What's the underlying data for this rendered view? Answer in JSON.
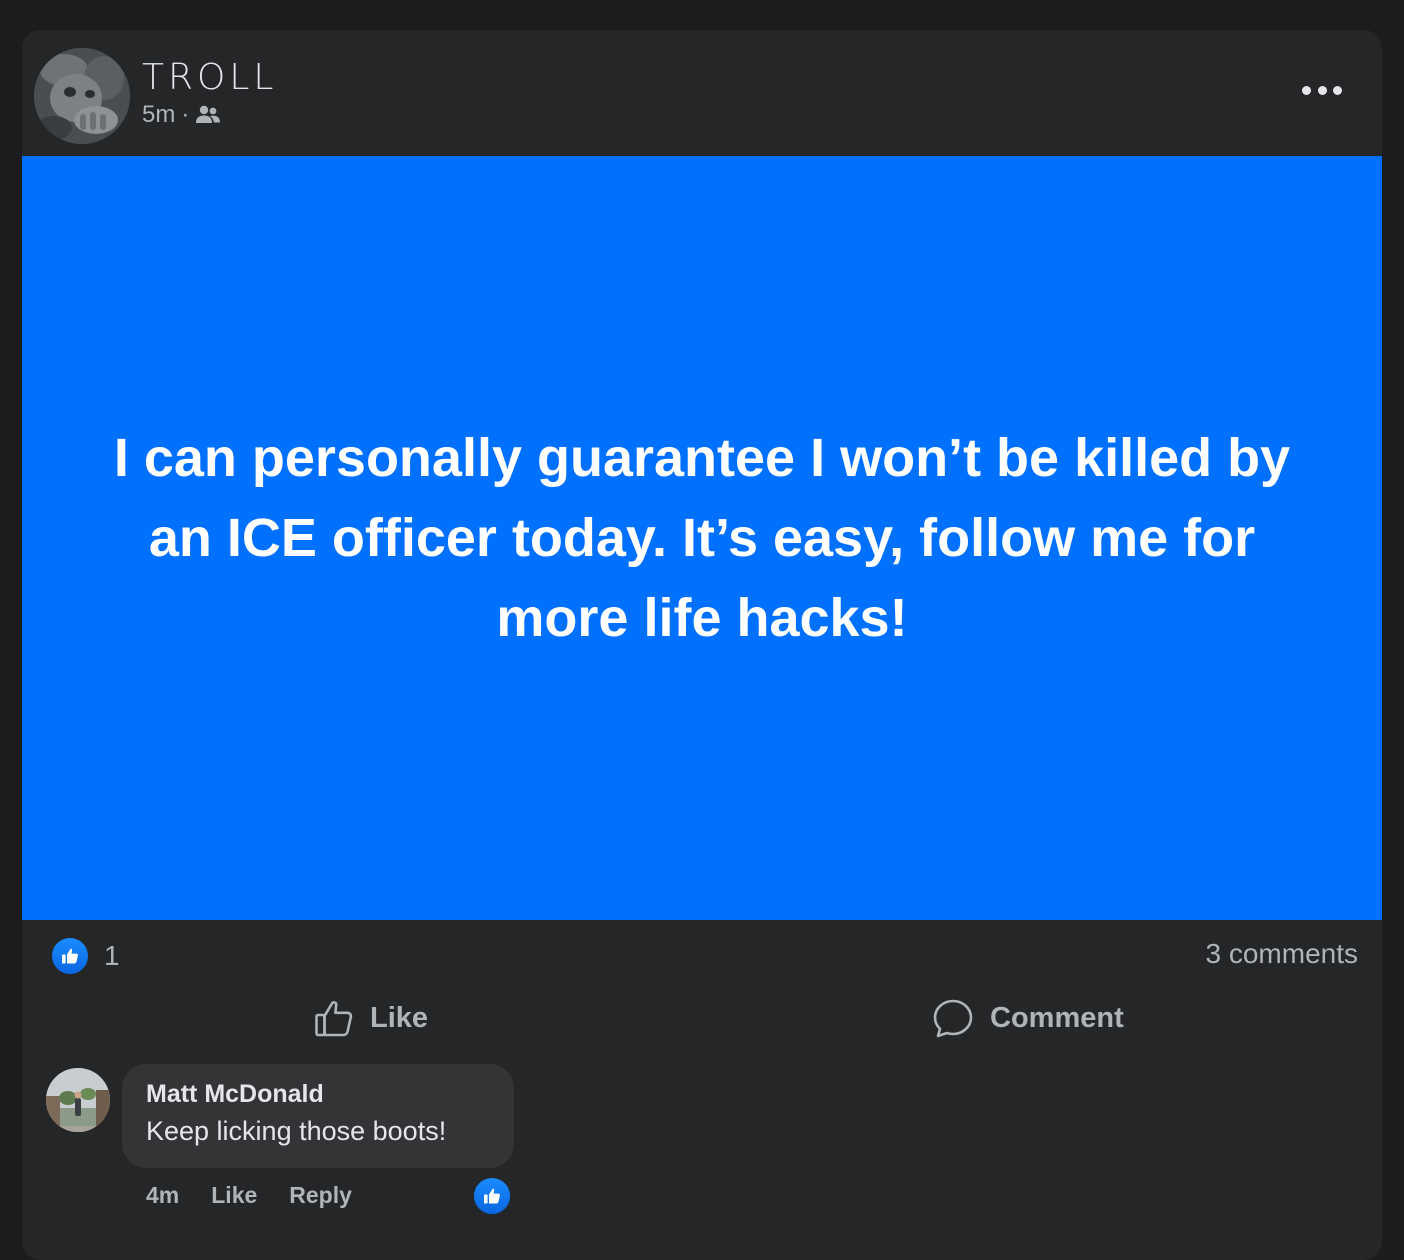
{
  "post": {
    "author": "TROLL",
    "time": "5m",
    "separator": "·",
    "audience_icon": "friends-icon",
    "more_icon": "more-options-icon",
    "text": "I can personally guarantee I won’t be killed by an ICE officer today. It’s easy, follow me for more life hacks!",
    "background_color": "#0070ff"
  },
  "stats": {
    "reaction_icon": "like-reaction-icon",
    "reaction_count": "1",
    "comments": "3 comments"
  },
  "actions": {
    "like": "Like",
    "comment": "Comment"
  },
  "comment": {
    "author": "Matt McDonald",
    "text": "Keep licking those boots!",
    "time": "4m",
    "like": "Like",
    "reply": "Reply",
    "reaction_icon": "like-reaction-icon"
  },
  "colors": {
    "page_bg": "#1c1c1e",
    "card_bg": "#252628",
    "bubble_bg": "#333436",
    "text_primary": "#e4e6eb",
    "text_secondary": "#b0b3b8",
    "like_blue": "#1a8cff"
  }
}
